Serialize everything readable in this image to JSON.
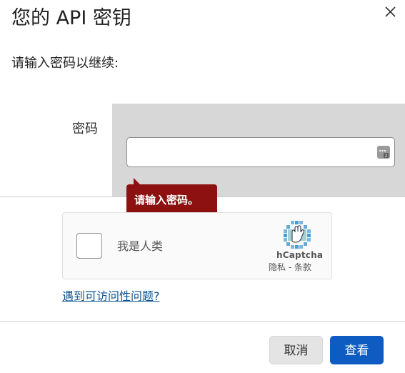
{
  "dialog": {
    "title": "您的 API 密钥",
    "prompt": "请输入密码以继续:"
  },
  "form": {
    "password_label": "密码",
    "password_value": "",
    "password_placeholder": "",
    "error_message": "请输入密码。"
  },
  "captcha": {
    "checkbox_label": "我是人类",
    "brand": "hCaptcha",
    "privacy_link": "隐私",
    "separator": " - ",
    "terms_link": "条款"
  },
  "accessibility_link": "遇到可访问性问题?",
  "buttons": {
    "cancel": "取消",
    "view": "查看"
  },
  "icons": {
    "close": "close-icon",
    "password_manager": "password-manager-icon",
    "captcha_logo": "hcaptcha-logo-icon"
  },
  "colors": {
    "primary_button": "#0e5cc1",
    "error_bubble": "#8e1111",
    "field_panel": "#d7d7d7",
    "link": "#0b5394"
  }
}
